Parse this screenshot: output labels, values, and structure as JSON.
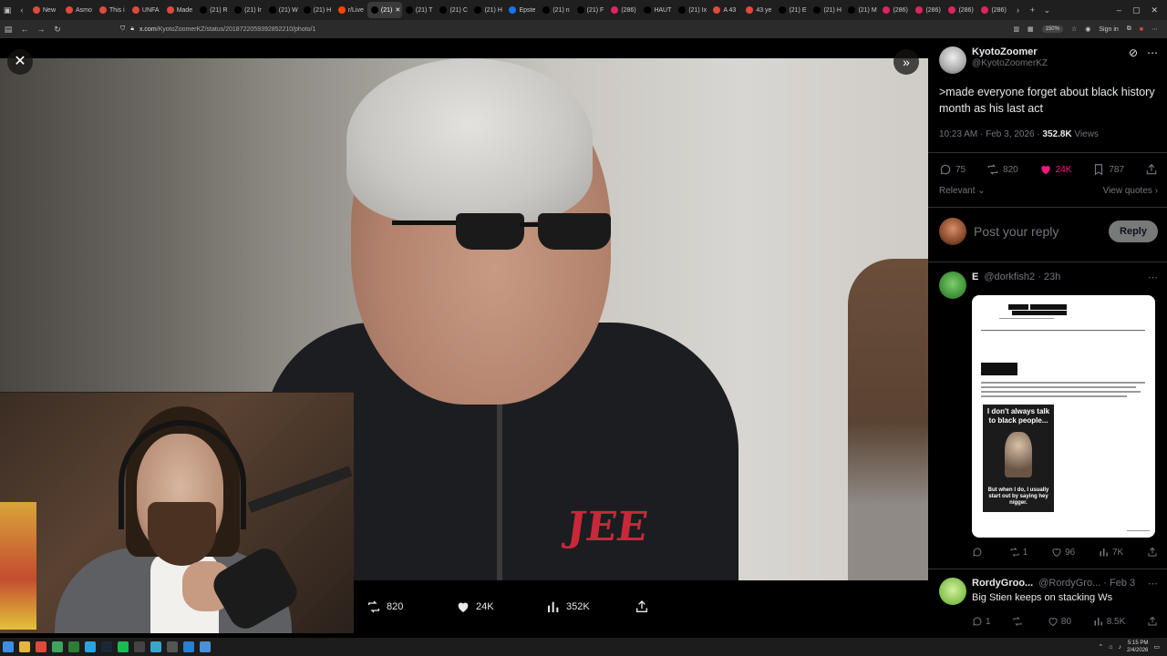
{
  "browser": {
    "tabs": [
      {
        "label": "New",
        "color": "#e04a3a"
      },
      {
        "label": "Asmo",
        "color": "#e04a3a"
      },
      {
        "label": "This i",
        "color": "#e04a3a"
      },
      {
        "label": "UNFA",
        "color": "#e04a3a"
      },
      {
        "label": "Made",
        "color": "#e04a3a"
      },
      {
        "label": "(21) R",
        "color": "#000000"
      },
      {
        "label": "(21) Ir",
        "color": "#000000"
      },
      {
        "label": "(21) W",
        "color": "#000000"
      },
      {
        "label": "(21) H",
        "color": "#000000"
      },
      {
        "label": "r/Live",
        "color": "#ff4500"
      },
      {
        "label": "(21)",
        "color": "#000000",
        "active": true
      },
      {
        "label": "(21) T",
        "color": "#000000"
      },
      {
        "label": "(21) C",
        "color": "#000000"
      },
      {
        "label": "(21) H",
        "color": "#000000"
      },
      {
        "label": "Epste",
        "color": "#1a73e8"
      },
      {
        "label": "(21) n",
        "color": "#000000"
      },
      {
        "label": "(21) F",
        "color": "#000000"
      },
      {
        "label": "(286)",
        "color": "#e0245e"
      },
      {
        "label": "HAUT",
        "color": "#000000"
      },
      {
        "label": "(21) Ix",
        "color": "#000000"
      },
      {
        "label": "A 43",
        "color": "#e04a3a"
      },
      {
        "label": "43 ye",
        "color": "#e04a3a"
      },
      {
        "label": "(21) E",
        "color": "#000000"
      },
      {
        "label": "(21) H",
        "color": "#000000"
      },
      {
        "label": "(21) M",
        "color": "#000000"
      },
      {
        "label": "(286)",
        "color": "#e0245e"
      },
      {
        "label": "(286)",
        "color": "#e0245e"
      },
      {
        "label": "(286)",
        "color": "#e0245e"
      },
      {
        "label": "(286)",
        "color": "#e0245e"
      }
    ],
    "url_host": "x.com",
    "url_path": "/KyotoZoomerKZ/status/2018722059392852210/photo/1",
    "zoom": "150%",
    "sign_in": "Sign in"
  },
  "tweet": {
    "display_name": "KyotoZoomer",
    "handle": "@KyotoZoomerKZ",
    "text": ">made everyone forget about black history month as his last act",
    "time": "10:23 AM · Feb 3, 2026 · ",
    "views_count": "352.8K",
    "views_label": " Views",
    "replies": "75",
    "retweets": "820",
    "likes": "24K",
    "bookmarks": "787",
    "relevant": "Relevant",
    "view_quotes": "View quotes",
    "reply_placeholder": "Post your reply",
    "reply_button": "Reply"
  },
  "media_bar": {
    "retweets": "820",
    "likes": "24K",
    "views": "352K"
  },
  "photo": {
    "logo_text": "JEE"
  },
  "comments": [
    {
      "name": "E",
      "handle": "@dorkfish2 · 23h",
      "meme_top": "I don't always talk to black people...",
      "meme_bottom": "But when I do, I usually start out by saying hey nigger.",
      "replies": "",
      "retweets": "1",
      "likes": "96",
      "views": "7K"
    },
    {
      "name": "RordyGroo...",
      "handle": "@RordyGro... · Feb 3",
      "text": "Big Stien keeps on stacking Ws",
      "replies": "1",
      "retweets": "",
      "likes": "80",
      "views": "8.5K"
    }
  ],
  "taskbar": {
    "time": "5:15 PM",
    "date": "2/4/2026"
  },
  "colors": {
    "like_pink": "#f91880",
    "x_bg": "#000000",
    "muted": "#71767b"
  }
}
